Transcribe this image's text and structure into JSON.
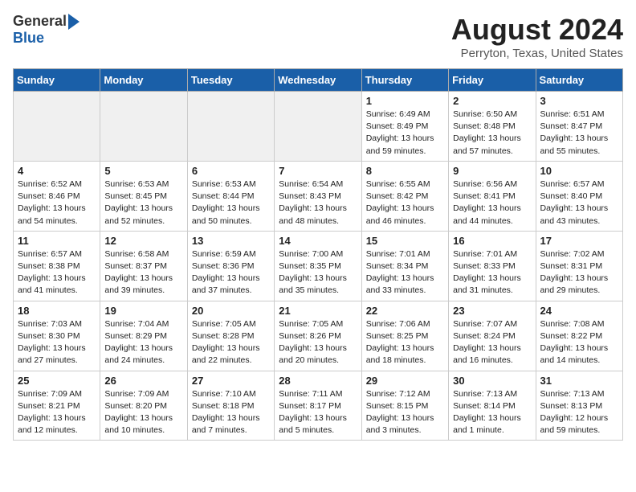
{
  "header": {
    "logo_general": "General",
    "logo_blue": "Blue",
    "title": "August 2024",
    "subtitle": "Perryton, Texas, United States"
  },
  "days_of_week": [
    "Sunday",
    "Monday",
    "Tuesday",
    "Wednesday",
    "Thursday",
    "Friday",
    "Saturday"
  ],
  "weeks": [
    [
      {
        "day": "",
        "empty": true
      },
      {
        "day": "",
        "empty": true
      },
      {
        "day": "",
        "empty": true
      },
      {
        "day": "",
        "empty": true
      },
      {
        "day": "1",
        "sunrise": "6:49 AM",
        "sunset": "8:49 PM",
        "daylight": "13 hours and 59 minutes."
      },
      {
        "day": "2",
        "sunrise": "6:50 AM",
        "sunset": "8:48 PM",
        "daylight": "13 hours and 57 minutes."
      },
      {
        "day": "3",
        "sunrise": "6:51 AM",
        "sunset": "8:47 PM",
        "daylight": "13 hours and 55 minutes."
      }
    ],
    [
      {
        "day": "4",
        "sunrise": "6:52 AM",
        "sunset": "8:46 PM",
        "daylight": "13 hours and 54 minutes."
      },
      {
        "day": "5",
        "sunrise": "6:53 AM",
        "sunset": "8:45 PM",
        "daylight": "13 hours and 52 minutes."
      },
      {
        "day": "6",
        "sunrise": "6:53 AM",
        "sunset": "8:44 PM",
        "daylight": "13 hours and 50 minutes."
      },
      {
        "day": "7",
        "sunrise": "6:54 AM",
        "sunset": "8:43 PM",
        "daylight": "13 hours and 48 minutes."
      },
      {
        "day": "8",
        "sunrise": "6:55 AM",
        "sunset": "8:42 PM",
        "daylight": "13 hours and 46 minutes."
      },
      {
        "day": "9",
        "sunrise": "6:56 AM",
        "sunset": "8:41 PM",
        "daylight": "13 hours and 44 minutes."
      },
      {
        "day": "10",
        "sunrise": "6:57 AM",
        "sunset": "8:40 PM",
        "daylight": "13 hours and 43 minutes."
      }
    ],
    [
      {
        "day": "11",
        "sunrise": "6:57 AM",
        "sunset": "8:38 PM",
        "daylight": "13 hours and 41 minutes."
      },
      {
        "day": "12",
        "sunrise": "6:58 AM",
        "sunset": "8:37 PM",
        "daylight": "13 hours and 39 minutes."
      },
      {
        "day": "13",
        "sunrise": "6:59 AM",
        "sunset": "8:36 PM",
        "daylight": "13 hours and 37 minutes."
      },
      {
        "day": "14",
        "sunrise": "7:00 AM",
        "sunset": "8:35 PM",
        "daylight": "13 hours and 35 minutes."
      },
      {
        "day": "15",
        "sunrise": "7:01 AM",
        "sunset": "8:34 PM",
        "daylight": "13 hours and 33 minutes."
      },
      {
        "day": "16",
        "sunrise": "7:01 AM",
        "sunset": "8:33 PM",
        "daylight": "13 hours and 31 minutes."
      },
      {
        "day": "17",
        "sunrise": "7:02 AM",
        "sunset": "8:31 PM",
        "daylight": "13 hours and 29 minutes."
      }
    ],
    [
      {
        "day": "18",
        "sunrise": "7:03 AM",
        "sunset": "8:30 PM",
        "daylight": "13 hours and 27 minutes."
      },
      {
        "day": "19",
        "sunrise": "7:04 AM",
        "sunset": "8:29 PM",
        "daylight": "13 hours and 24 minutes."
      },
      {
        "day": "20",
        "sunrise": "7:05 AM",
        "sunset": "8:28 PM",
        "daylight": "13 hours and 22 minutes."
      },
      {
        "day": "21",
        "sunrise": "7:05 AM",
        "sunset": "8:26 PM",
        "daylight": "13 hours and 20 minutes."
      },
      {
        "day": "22",
        "sunrise": "7:06 AM",
        "sunset": "8:25 PM",
        "daylight": "13 hours and 18 minutes."
      },
      {
        "day": "23",
        "sunrise": "7:07 AM",
        "sunset": "8:24 PM",
        "daylight": "13 hours and 16 minutes."
      },
      {
        "day": "24",
        "sunrise": "7:08 AM",
        "sunset": "8:22 PM",
        "daylight": "13 hours and 14 minutes."
      }
    ],
    [
      {
        "day": "25",
        "sunrise": "7:09 AM",
        "sunset": "8:21 PM",
        "daylight": "13 hours and 12 minutes."
      },
      {
        "day": "26",
        "sunrise": "7:09 AM",
        "sunset": "8:20 PM",
        "daylight": "13 hours and 10 minutes."
      },
      {
        "day": "27",
        "sunrise": "7:10 AM",
        "sunset": "8:18 PM",
        "daylight": "13 hours and 7 minutes."
      },
      {
        "day": "28",
        "sunrise": "7:11 AM",
        "sunset": "8:17 PM",
        "daylight": "13 hours and 5 minutes."
      },
      {
        "day": "29",
        "sunrise": "7:12 AM",
        "sunset": "8:15 PM",
        "daylight": "13 hours and 3 minutes."
      },
      {
        "day": "30",
        "sunrise": "7:13 AM",
        "sunset": "8:14 PM",
        "daylight": "13 hours and 1 minute."
      },
      {
        "day": "31",
        "sunrise": "7:13 AM",
        "sunset": "8:13 PM",
        "daylight": "12 hours and 59 minutes."
      }
    ]
  ]
}
